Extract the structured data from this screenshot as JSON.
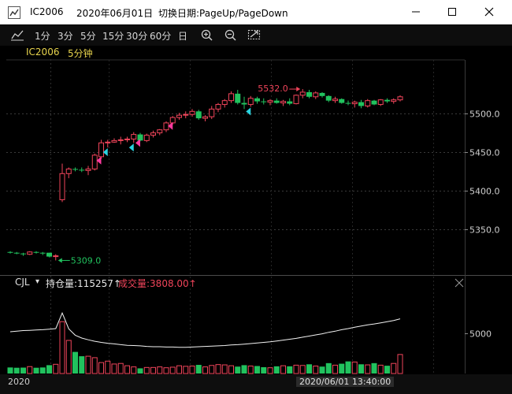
{
  "window": {
    "symbol": "IC2006",
    "date": "2020年06月01日",
    "hint": "切换日期:PageUp/PageDown",
    "controls": [
      "minimize-icon",
      "maximize-icon",
      "close-icon"
    ]
  },
  "toolbar": {
    "periods": [
      "1分",
      "3分",
      "5分",
      "15分",
      "30分",
      "60分",
      "日"
    ],
    "icons": [
      "line-chart-icon",
      "zoom-in-icon",
      "zoom-out-icon",
      "reset-zoom-icon"
    ]
  },
  "symbol_row": {
    "symbol": "IC2006",
    "period": "5分钟"
  },
  "indicator": {
    "name": "CJL",
    "dropdown": "▾",
    "oi_label": "持仓量:115257↑",
    "vol_label": "成交量:3808.00↑"
  },
  "time_axis": {
    "left_label": "2020",
    "crosshair_label": "2020/06/01  13:40:00"
  },
  "colors": {
    "up": "#f0445a",
    "down": "#21c25e",
    "grid": "#3a3a3a",
    "text": "#cfcfcf",
    "yellow": "#e8d44d",
    "buy_arrow": "#ff3aa0",
    "sell_arrow": "#2ad3e0"
  },
  "chart_data": [
    {
      "type": "candlestick",
      "title": "IC2006 5分钟",
      "y_ticks": [
        5350.0,
        5400.0,
        5450.0,
        5500.0
      ],
      "y_tick_labels": [
        "5350.0",
        "5400.0",
        "5450.0",
        "5500.0"
      ],
      "ylim": [
        5290,
        5570
      ],
      "annotations": [
        {
          "text": "5532.0",
          "value": 5532.0,
          "marks": "high"
        },
        {
          "text": "5309.0",
          "value": 5309.0,
          "marks": "low"
        }
      ],
      "candles": [
        [
          5320,
          5321,
          5318,
          5319
        ],
        [
          5319,
          5320,
          5317,
          5318
        ],
        [
          5318,
          5319,
          5315,
          5317
        ],
        [
          5317,
          5321,
          5316,
          5320
        ],
        [
          5320,
          5321,
          5318,
          5319
        ],
        [
          5319,
          5320,
          5316,
          5318
        ],
        [
          5319,
          5319,
          5313,
          5314
        ],
        [
          5314,
          5317,
          5309,
          5315
        ],
        [
          5388,
          5435,
          5385,
          5422
        ],
        [
          5422,
          5430,
          5416,
          5428
        ],
        [
          5428,
          5430,
          5425,
          5427
        ],
        [
          5427,
          5430,
          5424,
          5426
        ],
        [
          5426,
          5432,
          5420,
          5428
        ],
        [
          5428,
          5448,
          5426,
          5446
        ],
        [
          5444,
          5466,
          5441,
          5462
        ],
        [
          5462,
          5466,
          5456,
          5463
        ],
        [
          5463,
          5468,
          5462,
          5465
        ],
        [
          5465,
          5470,
          5460,
          5466
        ],
        [
          5466,
          5470,
          5463,
          5467
        ],
        [
          5467,
          5476,
          5462,
          5473
        ],
        [
          5473,
          5475,
          5464,
          5465
        ],
        [
          5465,
          5474,
          5463,
          5472
        ],
        [
          5472,
          5478,
          5469,
          5475
        ],
        [
          5475,
          5480,
          5472,
          5479
        ],
        [
          5479,
          5490,
          5476,
          5488
        ],
        [
          5488,
          5497,
          5486,
          5495
        ],
        [
          5495,
          5501,
          5492,
          5498
        ],
        [
          5498,
          5503,
          5494,
          5499
        ],
        [
          5499,
          5506,
          5496,
          5503
        ],
        [
          5503,
          5505,
          5492,
          5494
        ],
        [
          5494,
          5498,
          5490,
          5496
        ],
        [
          5496,
          5510,
          5493,
          5506
        ],
        [
          5506,
          5514,
          5502,
          5512
        ],
        [
          5512,
          5519,
          5508,
          5517
        ],
        [
          5517,
          5529,
          5514,
          5526
        ],
        [
          5526,
          5531,
          5512,
          5514
        ],
        [
          5514,
          5522,
          5506,
          5512
        ],
        [
          5512,
          5523,
          5509,
          5520
        ],
        [
          5520,
          5522,
          5513,
          5516
        ],
        [
          5516,
          5520,
          5512,
          5515
        ],
        [
          5515,
          5519,
          5511,
          5517
        ],
        [
          5517,
          5520,
          5513,
          5514
        ],
        [
          5514,
          5518,
          5510,
          5516
        ],
        [
          5516,
          5520,
          5511,
          5513
        ],
        [
          5513,
          5525,
          5512,
          5524
        ],
        [
          5524,
          5532,
          5520,
          5528
        ],
        [
          5528,
          5531,
          5520,
          5522
        ],
        [
          5522,
          5529,
          5519,
          5527
        ],
        [
          5527,
          5528,
          5521,
          5523
        ],
        [
          5523,
          5524,
          5515,
          5517
        ],
        [
          5517,
          5522,
          5514,
          5519
        ],
        [
          5519,
          5520,
          5513,
          5514
        ],
        [
          5514,
          5517,
          5511,
          5513
        ],
        [
          5513,
          5517,
          5508,
          5515
        ],
        [
          5515,
          5518,
          5507,
          5510
        ],
        [
          5510,
          5519,
          5508,
          5517
        ],
        [
          5517,
          5518,
          5511,
          5512
        ],
        [
          5512,
          5519,
          5510,
          5518
        ],
        [
          5518,
          5520,
          5514,
          5516
        ],
        [
          5516,
          5520,
          5513,
          5518
        ],
        [
          5518,
          5524,
          5516,
          5522
        ]
      ],
      "signals": [
        {
          "index": 14,
          "kind": "buy"
        },
        {
          "index": 15,
          "kind": "sell"
        },
        {
          "index": 19,
          "kind": "sell"
        },
        {
          "index": 20,
          "kind": "buy"
        },
        {
          "index": 25,
          "kind": "buy"
        },
        {
          "index": 37,
          "kind": "sell"
        }
      ]
    },
    {
      "type": "bar",
      "title": "CJL",
      "y_ticks": [
        5000
      ],
      "y_tick_labels": [
        "5000"
      ],
      "ylim": [
        3600,
        6500
      ],
      "volume": [
        3810,
        3800,
        3805,
        3840,
        3800,
        3810,
        3890,
        3920,
        5400,
        4750,
        4350,
        4200,
        4200,
        4150,
        3980,
        4030,
        3930,
        3950,
        3870,
        3830,
        3780,
        3810,
        3810,
        3830,
        3800,
        3820,
        3870,
        3850,
        3860,
        3900,
        3830,
        3880,
        3910,
        3900,
        3870,
        3840,
        3890,
        3860,
        3860,
        3820,
        3800,
        3850,
        3870,
        3850,
        3890,
        3880,
        3920,
        3860,
        3840,
        3960,
        3890,
        3940,
        4020,
        4000,
        3920,
        3900,
        3960,
        3890,
        3870,
        3950,
        4260
      ],
      "open_interest": [
        5050,
        5070,
        5090,
        5100,
        5110,
        5120,
        5140,
        5160,
        5700,
        5150,
        4930,
        4830,
        4770,
        4720,
        4680,
        4650,
        4630,
        4600,
        4580,
        4570,
        4560,
        4540,
        4530,
        4530,
        4520,
        4520,
        4510,
        4510,
        4520,
        4530,
        4540,
        4550,
        4560,
        4570,
        4590,
        4600,
        4620,
        4640,
        4660,
        4680,
        4700,
        4730,
        4760,
        4790,
        4820,
        4860,
        4900,
        4940,
        4980,
        5030,
        5070,
        5120,
        5160,
        5210,
        5250,
        5290,
        5320,
        5360,
        5400,
        5440,
        5500
      ]
    }
  ]
}
